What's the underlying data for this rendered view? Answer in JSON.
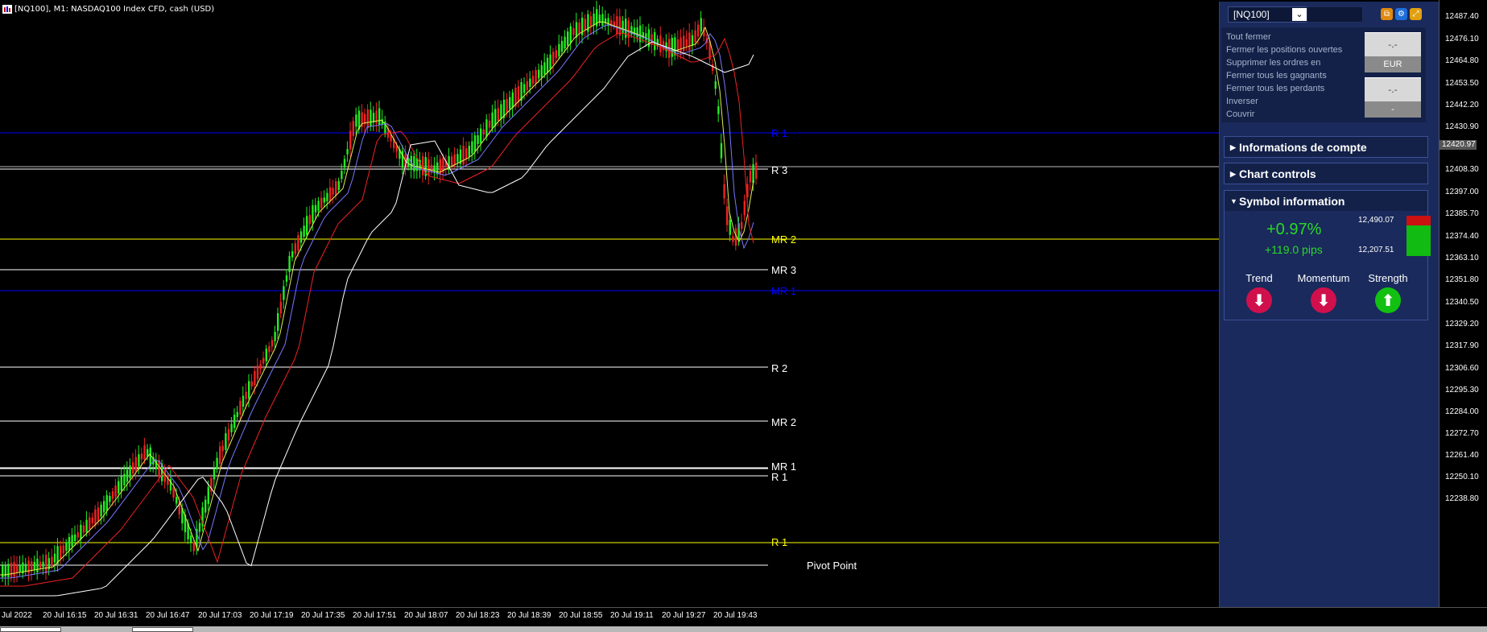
{
  "chart": {
    "title": "[NQ100], M1:  NASDAQ100 Index CFD, cash (USD)",
    "price_ticks": [
      "12487.40",
      "12476.10",
      "12464.80",
      "12453.50",
      "12442.20",
      "12430.90",
      "12420.97",
      "12408.30",
      "12397.00",
      "12385.70",
      "12374.40",
      "12363.10",
      "12351.80",
      "12340.50",
      "12329.20",
      "12317.90",
      "12306.60",
      "12295.30",
      "12284.00",
      "12272.70",
      "12261.40",
      "12250.10",
      "12238.80"
    ],
    "current_price": "12420.97",
    "time_ticks": [
      "Jul 2022",
      "20 Jul 16:15",
      "20 Jul 16:31",
      "20 Jul 16:47",
      "20 Jul 17:03",
      "20 Jul 17:19",
      "20 Jul 17:35",
      "20 Jul 17:51",
      "20 Jul 18:07",
      "20 Jul 18:23",
      "20 Jul 18:39",
      "20 Jul 18:55",
      "20 Jul 19:11",
      "20 Jul 19:27",
      "20 Jul 19:43"
    ],
    "levels": [
      {
        "label": "R 1",
        "color": "#0000ff"
      },
      {
        "label": "R 3",
        "color": "#ffffff"
      },
      {
        "label": "MR 2",
        "color": "#ffff00"
      },
      {
        "label": "MR 3",
        "color": "#ffffff"
      },
      {
        "label": "MR 1",
        "color": "#0000ff"
      },
      {
        "label": "R 2",
        "color": "#ffffff"
      },
      {
        "label": "MR 2",
        "color": "#ffffff"
      },
      {
        "label": "MR 1",
        "color": "#ffffff"
      },
      {
        "label": "R 1",
        "color": "#ffffff"
      },
      {
        "label": "R 1",
        "color": "#ffff00"
      },
      {
        "label": "Pivot Point",
        "color": "#ffffff"
      }
    ]
  },
  "panel": {
    "symbol": "[NQ100]",
    "menu": [
      "Tout fermer",
      "Fermer les positions ouvertes",
      "Supprimer les ordres en",
      "Fermer tous les gagnants",
      "Fermer tous les perdants",
      "Inverser",
      "Couvrir"
    ],
    "btn1": "-.-",
    "btn1_sub": "EUR",
    "btn2": "-.-",
    "btn2_sub": "-",
    "sections": [
      "Informations de compte",
      "Chart controls",
      "Symbol information"
    ],
    "symbol_info": {
      "change_pct": "+0.97%",
      "change_pips": "+119.0 pips",
      "high": "12,490.07",
      "low": "12,207.51",
      "indicators": [
        {
          "label": "Trend",
          "direction": "down",
          "color": "#d0104c"
        },
        {
          "label": "Momentum",
          "direction": "down",
          "color": "#d0104c"
        },
        {
          "label": "Strength",
          "direction": "up",
          "color": "#11c011"
        }
      ]
    }
  }
}
